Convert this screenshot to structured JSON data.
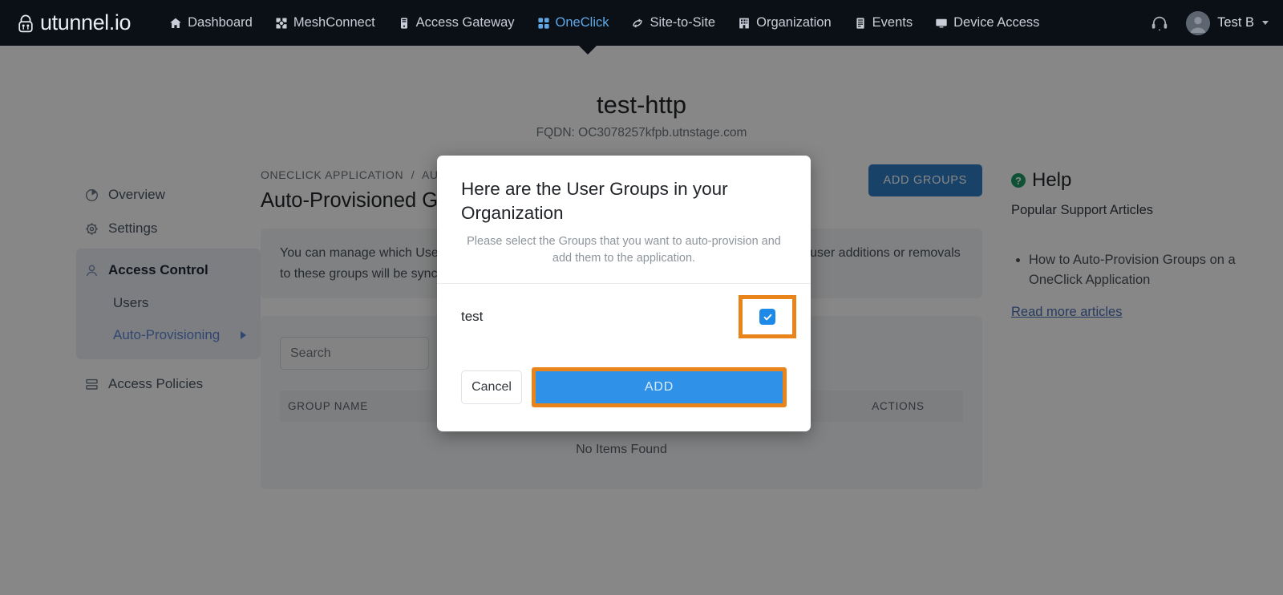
{
  "nav": {
    "logo_text": "utunnel.io",
    "items": [
      {
        "label": "Dashboard",
        "icon": "home-icon"
      },
      {
        "label": "MeshConnect",
        "icon": "mesh-icon"
      },
      {
        "label": "Access Gateway",
        "icon": "server-icon"
      },
      {
        "label": "OneClick",
        "icon": "grid-icon"
      },
      {
        "label": "Site-to-Site",
        "icon": "link-icon"
      },
      {
        "label": "Organization",
        "icon": "building-icon"
      },
      {
        "label": "Events",
        "icon": "list-icon"
      },
      {
        "label": "Device Access",
        "icon": "monitor-icon"
      }
    ],
    "active_index": 3,
    "support_icon": "headset-icon",
    "user_name": "Test B"
  },
  "header": {
    "title": "test-http",
    "fqdn": "FQDN: OC3078257kfpb.utnstage.com"
  },
  "sidebar": {
    "items": [
      {
        "label": "Overview",
        "icon": "pie-chart-icon"
      },
      {
        "label": "Settings",
        "icon": "gear-icon"
      },
      {
        "label": "Access Control",
        "icon": "user-icon"
      },
      {
        "label": "Users",
        "icon": ""
      },
      {
        "label": "Auto-Provisioning",
        "icon": ""
      },
      {
        "label": "Access Policies",
        "icon": "policies-icon"
      }
    ]
  },
  "main": {
    "breadcrumb_root": "ONECLICK APPLICATION",
    "breadcrumb_sep": "/",
    "breadcrumb_current": "AUTO-PROVISIONED GROUPS",
    "section_title": "Auto-Provisioned Groups",
    "add_groups_label": "ADD GROUPS",
    "info_text": "You can manage which User Groups are auto-provisioned into this OneClick Application. Any user additions or removals to these groups will be synced automatically.",
    "search_placeholder": "Search",
    "search_value": "",
    "table": {
      "columns": [
        "GROUP NAME",
        "ACTIONS"
      ],
      "rows": [],
      "empty_text": "No Items Found"
    }
  },
  "help": {
    "title": "Help",
    "icon": "question-mark-icon",
    "subtitle": "Popular Support Articles",
    "articles": [
      "How to Auto-Provision Groups on a OneClick Application"
    ],
    "read_more": "Read more articles"
  },
  "modal": {
    "title": "Here are the User Groups in your Organization",
    "subtitle": "Please select the Groups that you want to auto-provision and add them to the application.",
    "groups": [
      {
        "name": "test",
        "checked": true
      }
    ],
    "cancel_label": "Cancel",
    "add_label": "ADD"
  },
  "colors": {
    "nav_bg": "#0b1016",
    "accent_blue": "#2f91e8",
    "button_blue": "#2f7dc4",
    "highlight_orange": "#e8841a",
    "link_blue": "#4a6fb5",
    "help_green": "#1d9a63"
  }
}
